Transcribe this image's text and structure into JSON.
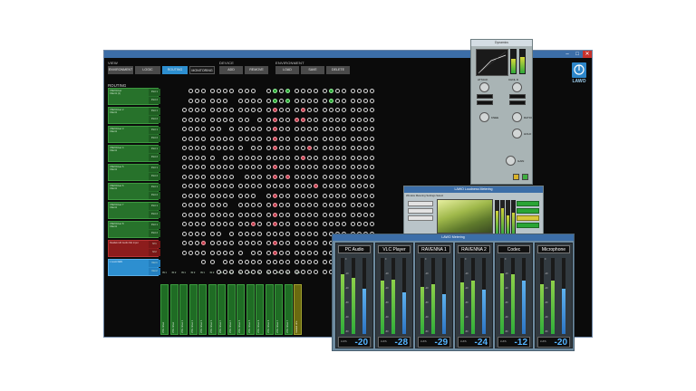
{
  "window": {
    "title": "",
    "min": "–",
    "max": "□",
    "close": "✕"
  },
  "toolbar": {
    "view_label": "VIEW",
    "device_label": "DEVICE",
    "environment_label": "ENVIRONMENT",
    "view_buttons": [
      "ENVIRONMENT",
      "LOGIC",
      "ROUTING",
      "MONITORING"
    ],
    "device_buttons": [
      "ADD",
      "REMOVE"
    ],
    "environment_buttons": [
      "LOAD",
      "SAVE",
      "DELETE"
    ]
  },
  "brand": {
    "logo": "LAWO",
    "accent": "#2d86c9"
  },
  "routing": {
    "title": "ROUTING",
    "sources": [
      {
        "name": "VSM Driver",
        "sub": "Client1 (1)",
        "ports": [
          "Port 1",
          "Port 2"
        ],
        "color": "green"
      },
      {
        "name": "VSM Driver 2",
        "sub": "Client1",
        "ports": [
          "Port 1",
          "Port 2"
        ],
        "color": "green"
      },
      {
        "name": "VSM Driver 3",
        "sub": "Client1",
        "ports": [
          "Port 1",
          "Port 2"
        ],
        "color": "green"
      },
      {
        "name": "VSM Driver 4",
        "sub": "Client1",
        "ports": [
          "Port 1",
          "Port 2"
        ],
        "color": "green"
      },
      {
        "name": "VSM Driver 5",
        "sub": "Client1",
        "ports": [
          "Port 1",
          "Port 2"
        ],
        "color": "green"
      },
      {
        "name": "VSM Driver 6",
        "sub": "Client1",
        "ports": [
          "Port 1",
          "Port 2"
        ],
        "color": "green"
      },
      {
        "name": "VSM Driver 7",
        "sub": "Client1",
        "ports": [
          "Port 1",
          "Port 2"
        ],
        "color": "green"
      },
      {
        "name": "VSM Driver 8",
        "sub": "Client1",
        "ports": [
          "Port 1",
          "Port 2"
        ],
        "color": "green"
      },
      {
        "name": "Realtek HD Audio Mic input",
        "sub": "",
        "ports": [
          "M 1",
          "M 2"
        ],
        "color": "red"
      },
      {
        "name": "L Level AES",
        "sub": "",
        "ports": [
          "Out 1",
          "Out 2"
        ],
        "color": "blue"
      }
    ],
    "destinations": [
      "VSM Driver",
      "VSM Driver",
      "VSM Driver 2",
      "VSM Driver 2",
      "VSM Driver 3",
      "VSM Driver 3",
      "VSM Driver 4",
      "VSM Driver 4",
      "VSM Driver 5",
      "VSM Driver 5",
      "VSM Driver 6",
      "VSM Driver 6",
      "VSM Driver 7",
      "VSM Driver 7",
      "Realtek Line"
    ],
    "dest_port_labels": [
      "IN 1",
      "IN 2"
    ]
  },
  "dynamics": {
    "title": "Dynamics",
    "labels": [
      "ATTACK",
      "CHNL D",
      "KNEE",
      "RATIO",
      "HOLD",
      "GAIN"
    ],
    "meter_levels": [
      0.62,
      0.7
    ]
  },
  "loudness": {
    "title": "LAWO Loudness Metering",
    "menu": "Window  Metering  Settings  Select",
    "meter_levels": [
      0.72,
      0.8,
      0.58,
      0.66
    ]
  },
  "metering": {
    "title": "LAWO Metering",
    "channels": [
      {
        "name": "PC Audio",
        "value": "-20",
        "levels": [
          0.78,
          0.74,
          0.6
        ]
      },
      {
        "name": "VLC Player",
        "value": "-28",
        "levels": [
          0.7,
          0.72,
          0.55
        ]
      },
      {
        "name": "RAVENNA 1",
        "value": "-29",
        "levels": [
          0.62,
          0.66,
          0.52
        ]
      },
      {
        "name": "RAVENNA 2",
        "value": "-24",
        "levels": [
          0.68,
          0.7,
          0.58
        ]
      },
      {
        "name": "Codec",
        "value": "-12",
        "levels": [
          0.8,
          0.78,
          0.7
        ]
      },
      {
        "name": "Microphone",
        "value": "-20",
        "levels": [
          0.66,
          0.7,
          0.6
        ]
      }
    ],
    "unit": "LUFS",
    "scale": [
      "0",
      "-10",
      "-20",
      "-30",
      "-40",
      "-50"
    ]
  }
}
